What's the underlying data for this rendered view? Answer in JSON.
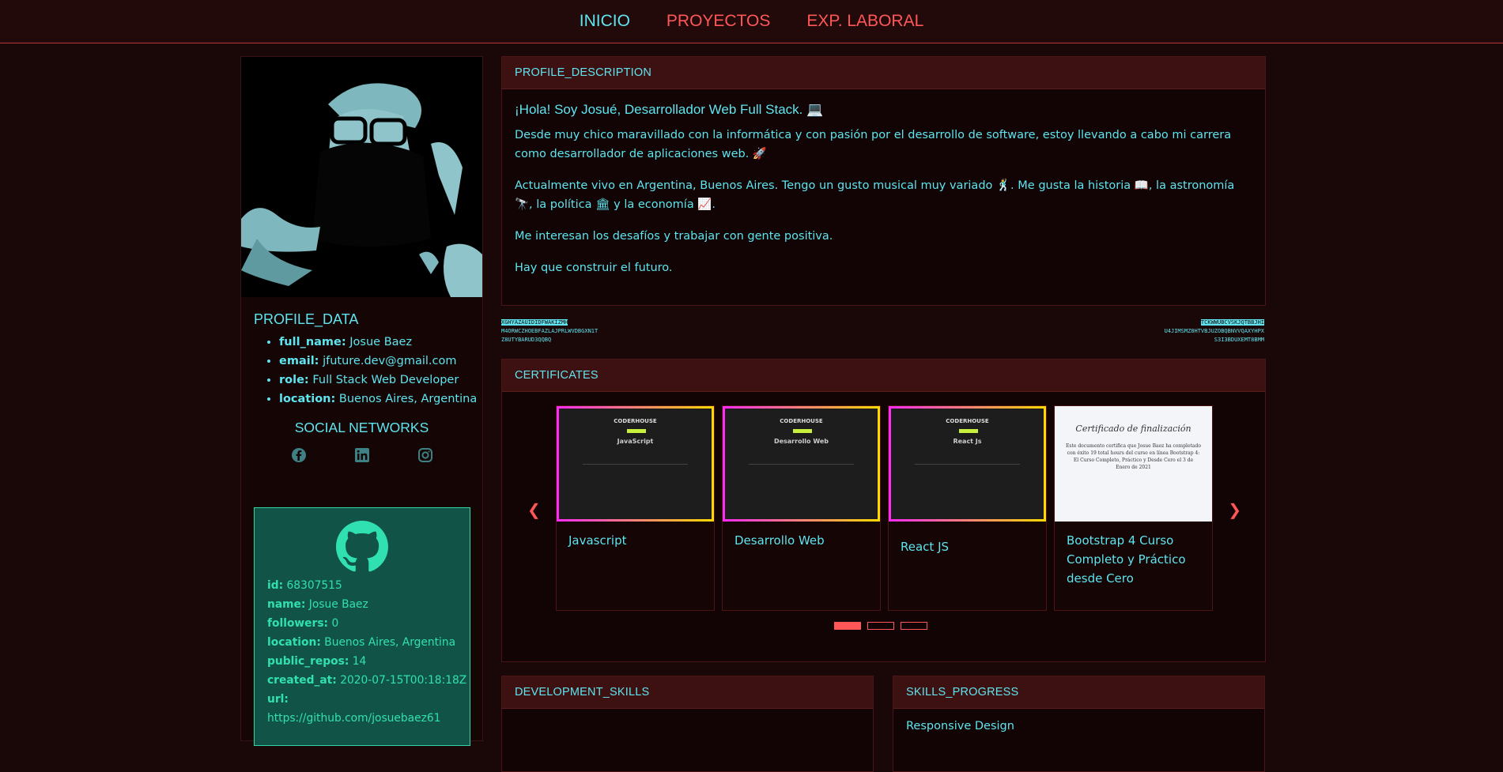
{
  "nav": {
    "items": [
      "INICIO",
      "PROYECTOS",
      "EXP. LABORAL"
    ]
  },
  "profile_data": {
    "title": "PROFILE_DATA",
    "fields": [
      {
        "key": "full_name:",
        "value": "Josue Baez"
      },
      {
        "key": "email:",
        "value": "jfuture.dev@gmail.com"
      },
      {
        "key": "role:",
        "value": "Full Stack Web Developer"
      },
      {
        "key": "location:",
        "value": "Buenos Aires, Argentina"
      }
    ]
  },
  "social": {
    "title": "SOCIAL NETWORKS",
    "icons": [
      "facebook-icon",
      "linkedin-icon",
      "instagram-icon"
    ]
  },
  "github": {
    "rows": [
      {
        "key": "id:",
        "value": "68307515"
      },
      {
        "key": "name:",
        "value": "Josue Baez"
      },
      {
        "key": "followers:",
        "value": "0"
      },
      {
        "key": "location:",
        "value": "Buenos Aires, Argentina"
      },
      {
        "key": "public_repos:",
        "value": "14"
      },
      {
        "key": "created_at:",
        "value": "2020-07-15T00:18:18Z"
      },
      {
        "key": "url:",
        "value": ""
      },
      {
        "key": "",
        "value": "https://github.com/josuebaez61"
      }
    ]
  },
  "description": {
    "header": "PROFILE_DESCRIPTION",
    "heading": "¡Hola! Soy Josué, Desarrollador Web Full Stack. 💻",
    "paragraphs": [
      "Desde muy chico maravillado con la informática y con pasión por el desarrollo de software, estoy llevando a cabo mi carrera como desarrollador de aplicaciones web. 🚀",
      "Actualmente vivo en Argentina, Buenos Aires. Tengo un gusto musical muy variado 🕺. Me gusta la historia 📖, la astronomía 🔭, la política 🏛 y la economía 📈.",
      "Me interesan los desafíos y trabajar con gente positiva.",
      "Hay que construir el futuro."
    ]
  },
  "glitch": {
    "left": [
      "XGHYAZAUIDIDFWAKIZMH",
      "M4ORWCZHOEBFAZLAJPRLWVDBGXN1T",
      "Z8UTYBARUD3QQBQ"
    ],
    "right": [
      "TCKWWUBCVSKJQTBBJHI",
      "U4JIMSMZ8HTVBJUZOBQBNVVQAXYHPX",
      "S3I3BDUXEMT8BMM"
    ]
  },
  "certificates": {
    "header": "CERTIFICATES",
    "cards": [
      {
        "label": "Javascript",
        "thumb_title": "JavaScript",
        "brand": "CODERHOUSE"
      },
      {
        "label": "Desarrollo Web",
        "thumb_title": "Desarrollo Web",
        "brand": "CODERHOUSE"
      },
      {
        "label": "React JS",
        "thumb_title": "React Js",
        "brand": "CODERHOUSE"
      },
      {
        "label": "Bootstrap 4 Curso Completo y Práctico desde Cero",
        "thumb_title": "Certificado de finalización",
        "thumb_text": "Este documento certifica que Josue Baez ha completado con éxito 19 total hours del curso en línea Bootstrap 4: El Curso Completo, Práctico y Desde Cero el 3 de Enero de 2021"
      }
    ],
    "dots_active_index": 0
  },
  "dev_skills": {
    "header": "DEVELOPMENT_SKILLS"
  },
  "skills_progress": {
    "header": "SKILLS_PROGRESS",
    "first_item": "Responsive Design"
  },
  "colors": {
    "accent": "#5ee5f0",
    "nav_inactive": "#ff5757",
    "panel_header": "#3d1111",
    "github_bg": "#115447"
  }
}
